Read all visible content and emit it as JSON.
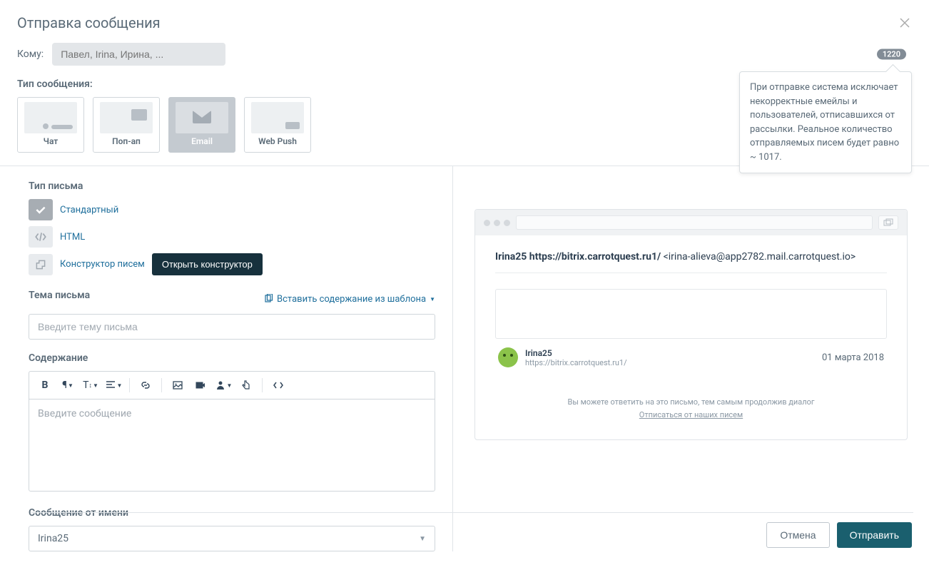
{
  "header": {
    "title": "Отправка сообщения"
  },
  "recipient": {
    "label": "Кому:",
    "placeholder": "Павел, Irina, Ирина, ...",
    "count": "1220"
  },
  "tooltip": "При отправке система исключает некорректные емейлы и пользователей, отписавшихся от рассылки. Реальное количество отправляемых писем будет равно ~ 1017.",
  "messageType": {
    "label": "Тип сообщения:",
    "cards": [
      {
        "label": "Чат"
      },
      {
        "label": "Поп-ап"
      },
      {
        "label": "Email"
      },
      {
        "label": "Web Push"
      }
    ]
  },
  "letterType": {
    "label": "Тип письма",
    "options": [
      {
        "label": "Стандартный"
      },
      {
        "label": "HTML"
      },
      {
        "label": "Конструктор писем"
      }
    ],
    "openBuilder": "Открыть конструктор"
  },
  "subject": {
    "label": "Тема письма",
    "insertTemplate": "Вставить содержание из шаблона",
    "placeholder": "Введите тему письма"
  },
  "content": {
    "label": "Содержание",
    "placeholder": "Введите сообщение"
  },
  "fromName": {
    "label": "Сообщение от имени",
    "value": "Irina25"
  },
  "preview": {
    "fromBold": "Irina25 https://bitrix.carrotquest.ru1/",
    "fromEmail": " <irina-alieva@app2782.mail.carrotquest.io>",
    "userName": "Irina25",
    "userUrl": "https://bitrix.carrotquest.ru1/",
    "date": "01 марта 2018",
    "disclaimer1": "Вы можете ответить на это письмо, тем самым продолжив диалог",
    "disclaimer2": "Отписаться от наших писем"
  },
  "actions": {
    "cancel": "Отмена",
    "send": "Отправить"
  }
}
